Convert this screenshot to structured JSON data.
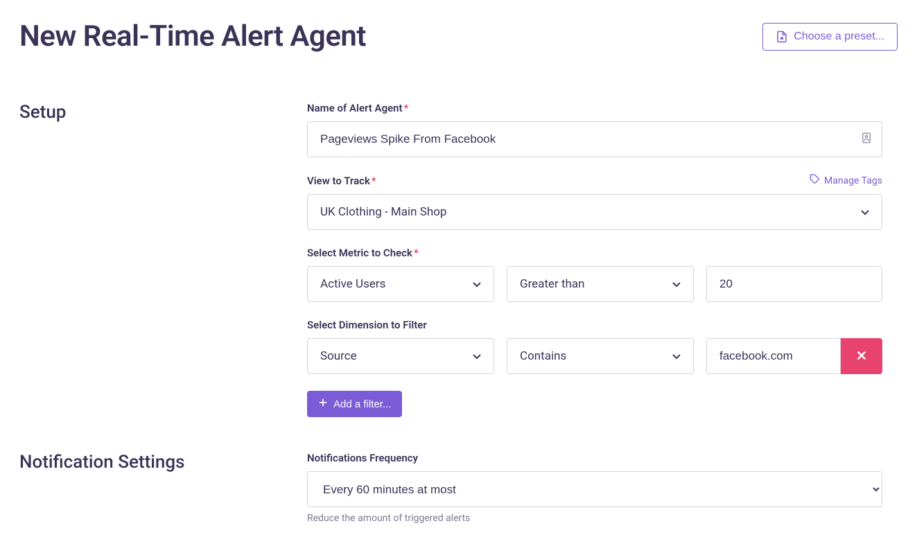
{
  "header": {
    "title": "New Real-Time Alert Agent",
    "preset_button": "Choose a preset..."
  },
  "setup": {
    "section_title": "Setup",
    "name_label": "Name of Alert Agent",
    "name_value": "Pageviews Spike From Facebook",
    "manage_tags": "Manage Tags",
    "view_label": "View to Track",
    "view_value": "UK Clothing - Main Shop",
    "metric_label": "Select Metric to Check",
    "metric_value": "Active Users",
    "comparator_value": "Greater than",
    "threshold_value": "20",
    "dimension_label": "Select Dimension to Filter",
    "dimension_value": "Source",
    "operator_value": "Contains",
    "filter_value": "facebook.com",
    "add_filter_button": "Add a filter..."
  },
  "notifications": {
    "section_title": "Notification Settings",
    "frequency_label": "Notifications Frequency",
    "frequency_value": "Every 60 minutes at most",
    "frequency_helper": "Reduce the amount of triggered alerts"
  }
}
